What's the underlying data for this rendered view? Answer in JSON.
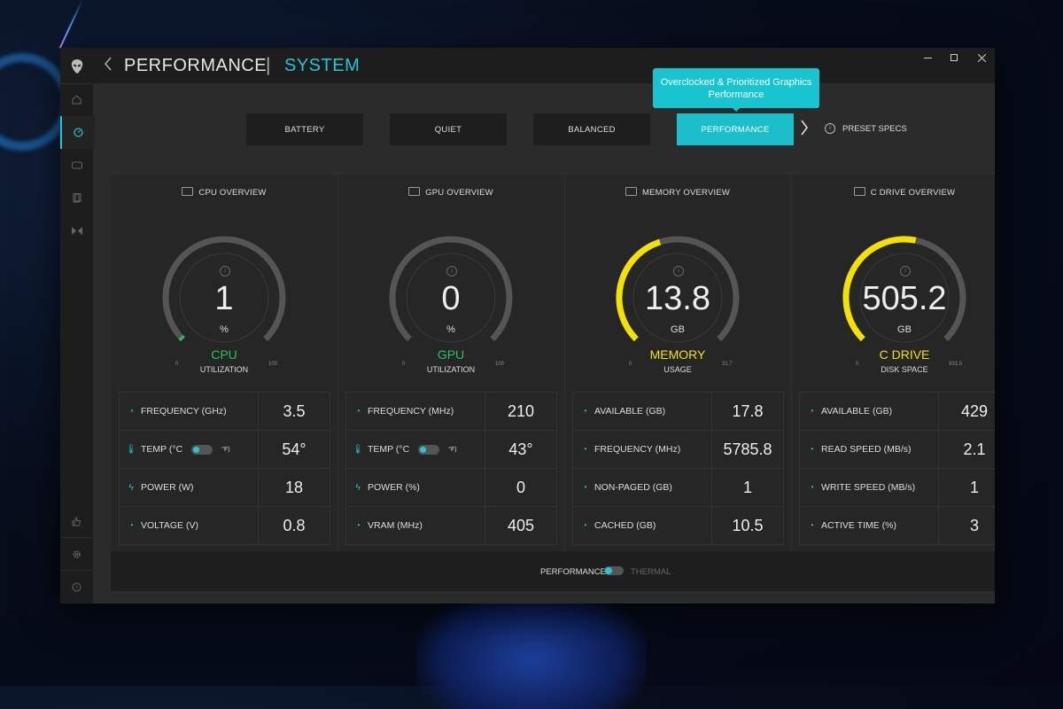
{
  "header": {
    "title": "PERFORMANCE",
    "separator": "|",
    "subtitle": "SYSTEM"
  },
  "window_controls": {
    "minimize": "—",
    "maximize": "☐",
    "close": "✕"
  },
  "tooltip": {
    "text": "Overclocked & Prioritized Graphics Performance"
  },
  "presets": [
    {
      "label": "BATTERY",
      "active": false
    },
    {
      "label": "QUIET",
      "active": false
    },
    {
      "label": "BALANCED",
      "active": false
    },
    {
      "label": "PERFORMANCE",
      "active": true
    }
  ],
  "preset_specs_label": "PRESET SPECS",
  "accent_color": "#23c6d6",
  "cards": [
    {
      "title": "CPU OVERVIEW",
      "icon": "cpu-icon",
      "gauge": {
        "value": "1",
        "unit": "%",
        "label": "CPU",
        "sub": "UTILIZATION",
        "min": "0",
        "max": "100",
        "fraction": 0.01,
        "color": "#22c55e"
      },
      "stats": [
        {
          "icon": "gauge-icon",
          "label": "FREQUENCY (GHz)",
          "value": "3.5"
        },
        {
          "icon": "thermometer-icon",
          "label": "TEMP (°C",
          "label_suffix": "°F)",
          "toggle": true,
          "value": "54°"
        },
        {
          "icon": "bolt-icon",
          "label": "POWER (W)",
          "value": "18"
        },
        {
          "icon": "gauge-icon",
          "label": "VOLTAGE (V)",
          "value": "0.8"
        }
      ]
    },
    {
      "title": "GPU OVERVIEW",
      "icon": "gpu-icon",
      "gauge": {
        "value": "0",
        "unit": "%",
        "label": "GPU",
        "sub": "UTILIZATION",
        "min": "0",
        "max": "100",
        "fraction": 0.0,
        "color": "#22c55e"
      },
      "stats": [
        {
          "icon": "gauge-icon",
          "label": "FREQUENCY (MHz)",
          "value": "210"
        },
        {
          "icon": "thermometer-icon",
          "label": "TEMP (°C",
          "label_suffix": "°F)",
          "toggle": true,
          "value": "43°"
        },
        {
          "icon": "bolt-icon",
          "label": "POWER (%)",
          "value": "0"
        },
        {
          "icon": "gauge-icon",
          "label": "VRAM (MHz)",
          "value": "405"
        }
      ]
    },
    {
      "title": "MEMORY OVERVIEW",
      "icon": "memory-icon",
      "gauge": {
        "value": "13.8",
        "unit": "GB",
        "label": "MEMORY",
        "sub": "USAGE",
        "min": "0",
        "max": "31.7",
        "fraction": 0.435,
        "color": "#f5e000"
      },
      "stats": [
        {
          "icon": "gauge-icon",
          "label": "AVAILABLE (GB)",
          "value": "17.8"
        },
        {
          "icon": "gauge-icon",
          "label": "FREQUENCY (MHz)",
          "value": "5785.8"
        },
        {
          "icon": "gauge-icon",
          "label": "NON-PAGED (GB)",
          "value": "1"
        },
        {
          "icon": "gauge-icon",
          "label": "CACHED (GB)",
          "value": "10.5"
        }
      ]
    },
    {
      "title": "C DRIVE OVERVIEW",
      "icon": "drive-icon",
      "gauge": {
        "value": "505.2",
        "unit": "GB",
        "label": "C DRIVE",
        "sub": "DISK SPACE",
        "min": "0",
        "max": "933.9",
        "fraction": 0.541,
        "color": "#f5e000"
      },
      "stats": [
        {
          "icon": "gauge-icon",
          "label": "AVAILABLE (GB)",
          "value": "429"
        },
        {
          "icon": "gauge-icon",
          "label": "READ SPEED (MB/s)",
          "value": "2.1"
        },
        {
          "icon": "gauge-icon",
          "label": "WRITE SPEED (MB/s)",
          "value": "1"
        },
        {
          "icon": "gauge-icon",
          "label": "ACTIVE TIME (%)",
          "value": "3"
        }
      ]
    }
  ],
  "footer": {
    "left_label": "PERFORMANCE",
    "right_label": "THERMAL",
    "toggle_on": true
  }
}
